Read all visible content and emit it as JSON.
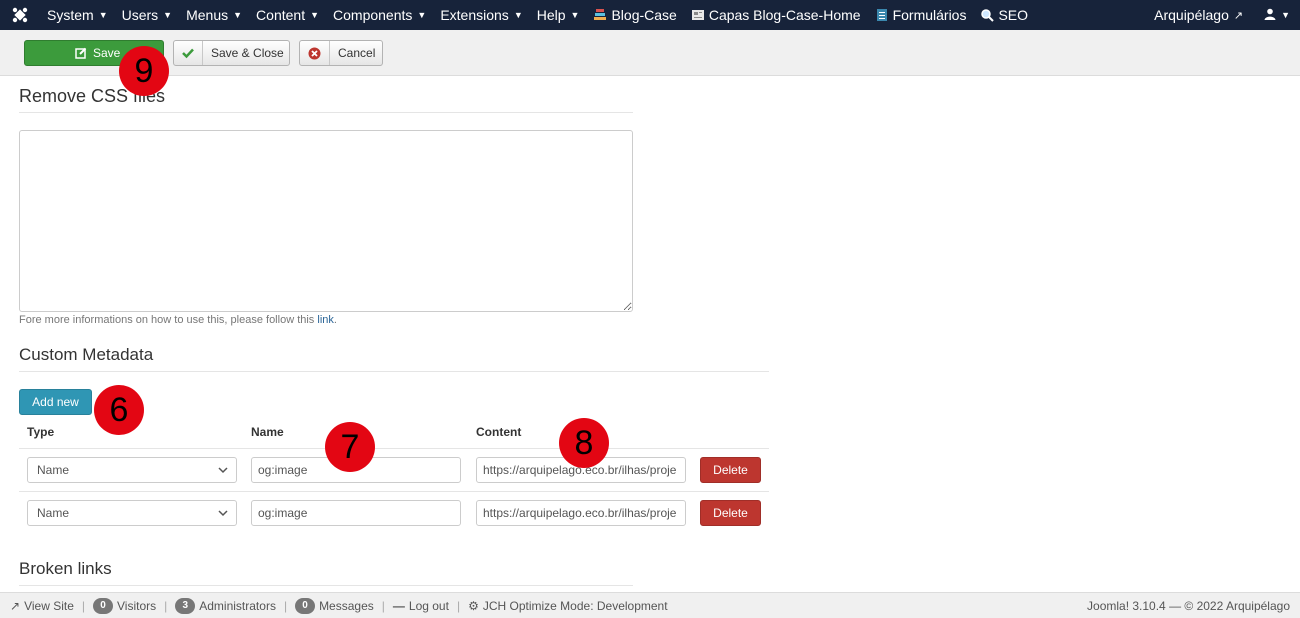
{
  "navbar": {
    "menus": [
      {
        "label": "System",
        "has_caret": true
      },
      {
        "label": "Users",
        "has_caret": true
      },
      {
        "label": "Menus",
        "has_caret": true
      },
      {
        "label": "Content",
        "has_caret": true
      },
      {
        "label": "Components",
        "has_caret": true
      },
      {
        "label": "Extensions",
        "has_caret": true
      },
      {
        "label": "Help",
        "has_caret": true
      }
    ],
    "quick_links": [
      "Blog-Case",
      "Capas Blog-Case-Home",
      "Formulários",
      "SEO"
    ],
    "site_name": "Arquipélago",
    "user_icon": "user-icon"
  },
  "toolbar": {
    "save_label": "Save",
    "save_close_label": "Save & Close",
    "cancel_label": "Cancel"
  },
  "sections": {
    "remove_css": {
      "title": "Remove CSS files",
      "textarea_value": ""
    },
    "help": {
      "prefix": "Fore more informations on how to use this, please follow this ",
      "link": "link",
      "suffix": "."
    },
    "custom_metadata": {
      "title": "Custom Metadata",
      "add_label": "Add new"
    },
    "broken_links": {
      "title": "Broken links"
    }
  },
  "metadata_table": {
    "headers": [
      "Type",
      "Name",
      "Content"
    ],
    "rows": [
      {
        "type": "Name",
        "name": "og:image",
        "content": "https://arquipelago.eco.br/ilhas/proje",
        "delete_label": "Delete"
      },
      {
        "type": "Name",
        "name": "og:image",
        "content": "https://arquipelago.eco.br/ilhas/proje",
        "delete_label": "Delete"
      }
    ]
  },
  "markers": [
    "9",
    "6",
    "7",
    "8"
  ],
  "footer": {
    "view_site": "View Site",
    "visitors_count": "0",
    "visitors_label": "Visitors",
    "admins_count": "3",
    "admins_label": "Administrators",
    "messages_count": "0",
    "messages_label": "Messages",
    "logout": "Log out",
    "jch": "JCH Optimize Mode: Development",
    "copyright": "Joomla! 3.10.4 — © 2022 Arquipélago"
  },
  "colors": {
    "navbar": "#17233a",
    "save": "#3c9b3c",
    "add": "#2f96b4",
    "delete": "#bd362f",
    "marker": "#e30613"
  }
}
